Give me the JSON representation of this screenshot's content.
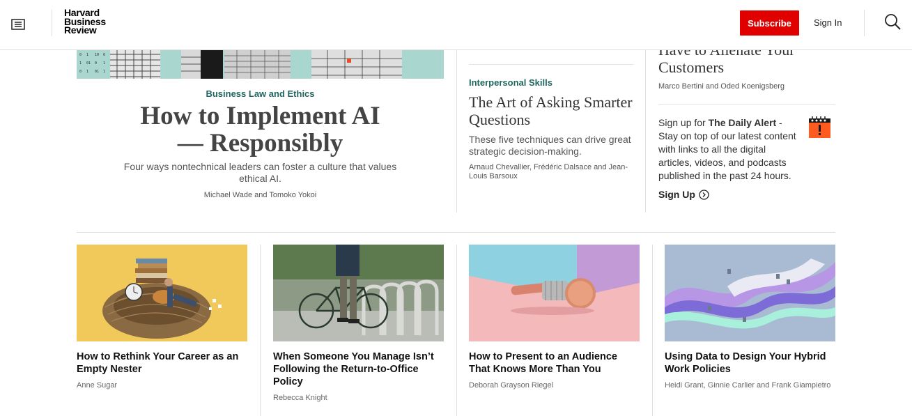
{
  "header": {
    "logo": [
      "Harvard",
      "Business",
      "Review"
    ],
    "subscribe_label": "Subscribe",
    "signin_label": "Sign In"
  },
  "hero": {
    "kicker": "Business Law and Ethics",
    "title_line1": "How to Implement AI",
    "title_line2": "— Responsibly",
    "dek": "Four ways nontechnical leaders can foster a culture that values ethical AI.",
    "byline": "Michael Wade and Tomoko Yokoi"
  },
  "middle": {
    "cut_text": "…",
    "kicker": "Interpersonal Skills",
    "title": "The Art of Asking Smarter Questions",
    "dek": "These five techniques can drive great strategic decision-making.",
    "byline": "Arnaud Chevallier, Frédéric Dalsace and Jean-Louis Barsoux"
  },
  "right": {
    "cut_title_line1": "Have to Alienate Your",
    "cut_title_line2": "Customers",
    "byline": "Marco Bertini and Oded Koenigsberg",
    "alert_prefix": "Sign up for ",
    "alert_name": "The Daily Alert",
    "alert_suffix": " - Stay on top of our latest content with links to all the digital articles, videos, and podcasts published in the past 24 hours.",
    "signup_label": "Sign Up"
  },
  "cards": [
    {
      "title": "How to Rethink Your Career as an Empty Nester",
      "author": "Anne Sugar"
    },
    {
      "title": "When Someone You Manage Isn’t Following the Return-to-Office Policy",
      "author": "Rebecca Knight"
    },
    {
      "title": "How to Present to an Audience That Knows More Than You",
      "author": "Deborah Grayson Riegel"
    },
    {
      "title": "Using Data to Design Your Hybrid Work Policies",
      "author": "Heidi Grant, Ginnie Carlier and Frank Giampietro"
    }
  ],
  "icons": {
    "menu": "menu-icon",
    "search": "search-icon",
    "signup_arrow": "chevron-circle-right-icon",
    "alert": "calendar-alert-icon"
  },
  "colors": {
    "accent_red": "#e00000",
    "kicker_teal": "#1f6660",
    "alert_orange": "#ff5a1f"
  }
}
